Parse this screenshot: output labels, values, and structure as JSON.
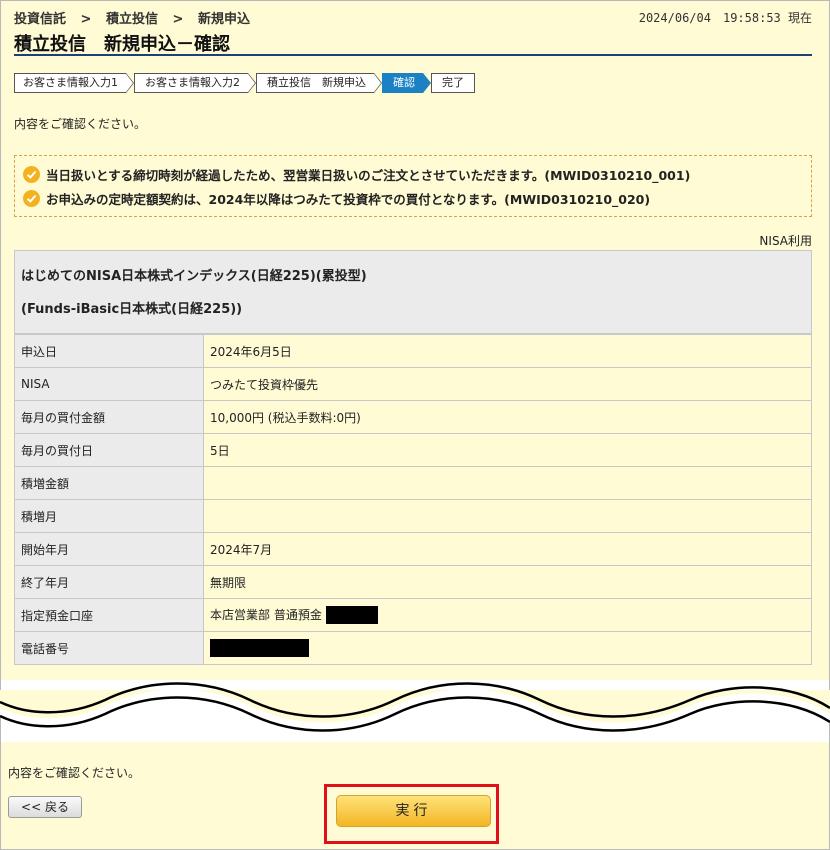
{
  "breadcrumb": [
    "投資信託",
    "積立投信",
    "新規申込"
  ],
  "breadcrumb_sep": ">",
  "datetime": "2024/06/04　19:58:53 現在",
  "title": "積立投信　新規申込－確認",
  "steps": [
    "お客さま情報入力1",
    "お客さま情報入力2",
    "積立投信　新規申込",
    "確認",
    "完了"
  ],
  "active_step": 3,
  "confirm_text": "内容をご確認ください。",
  "notices": [
    "当日扱いとする締切時刻が経過したため、翌営業日扱いのご注文とさせていただきます。(MWID0310210_001)",
    "お申込みの定時定額契約は、2024年以降はつみたて投資枠での買付となります。(MWID0310210_020)"
  ],
  "nisa_label": "NISA利用",
  "fund": {
    "name": "はじめてのNISA日本株式インデックス(日経225)(累投型)",
    "subname": "(Funds-iBasic日本株式(日経225))"
  },
  "details": [
    {
      "label": "申込日",
      "value": "2024年6月5日"
    },
    {
      "label": "NISA",
      "value": "つみたて投資枠優先"
    },
    {
      "label": "毎月の買付金額",
      "value": "10,000円 (税込手数料:0円)"
    },
    {
      "label": "毎月の買付日",
      "value": "5日"
    },
    {
      "label": "積増金額",
      "value": ""
    },
    {
      "label": "積増月",
      "value": ""
    },
    {
      "label": "開始年月",
      "value": "2024年7月"
    },
    {
      "label": "終了年月",
      "value": "無期限"
    },
    {
      "label": "指定預金口座",
      "value": "本店営業部 普通預金"
    },
    {
      "label": "電話番号",
      "value": ""
    }
  ],
  "bottom_text": "内容をご確認ください。",
  "back_button": "<< 戻る",
  "exec_button": "実行",
  "colors": {
    "panel": "#fffbd5",
    "active_step": "#1a82c4",
    "exec_button": "#f2b624",
    "highlight": "#e0101a"
  }
}
